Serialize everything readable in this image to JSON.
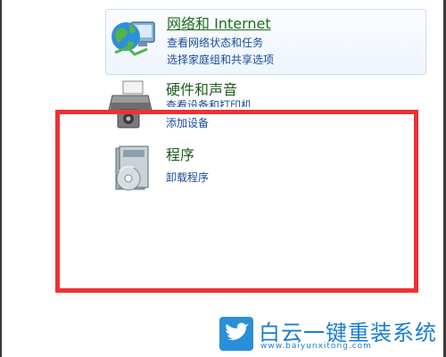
{
  "categories": {
    "network": {
      "title": "网络和 Internet",
      "links": [
        "查看网络状态和任务",
        "选择家庭组和共享选项"
      ],
      "icon": "globe-network-icon"
    },
    "hardware": {
      "title": "硬件和声音",
      "links": [
        "查看设备和打印机",
        "添加设备"
      ],
      "icon": "printer-speaker-icon"
    },
    "programs": {
      "title": "程序",
      "links": [
        "卸载程序"
      ],
      "icon": "programs-disc-icon"
    }
  },
  "watermark": {
    "title": "白云一键重装系统",
    "url": "www.baiyunxitong.com",
    "icon": "twitter-bird-icon"
  },
  "colors": {
    "highlight": "#ee3135",
    "link": "#1a4a9c",
    "title": "#1f5a1f",
    "watermark": "#1b7ed0"
  }
}
